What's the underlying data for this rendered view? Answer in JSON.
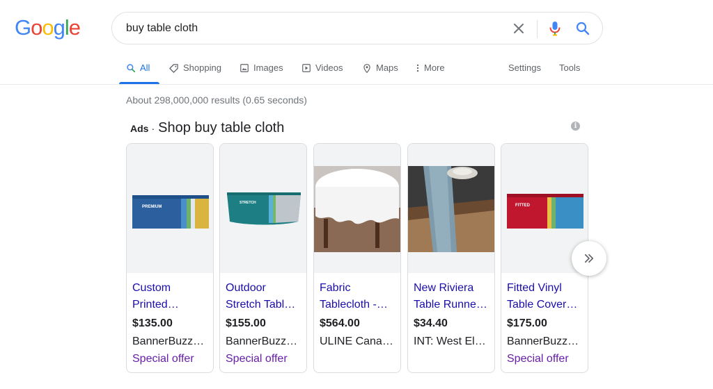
{
  "logo": {
    "letters": [
      "G",
      "o",
      "o",
      "g",
      "l",
      "e"
    ],
    "colors": [
      "#4285f4",
      "#ea4335",
      "#fbbc05",
      "#4285f4",
      "#34a853",
      "#ea4335"
    ]
  },
  "search": {
    "query": "buy table cloth",
    "icons": {
      "clear": "close-icon",
      "voice": "microphone-icon",
      "submit": "search-icon"
    }
  },
  "tabs": [
    {
      "label": "All",
      "icon": "search-icon",
      "active": true
    },
    {
      "label": "Shopping",
      "icon": "tag-icon",
      "active": false
    },
    {
      "label": "Images",
      "icon": "image-icon",
      "active": false
    },
    {
      "label": "Videos",
      "icon": "play-icon",
      "active": false
    },
    {
      "label": "Maps",
      "icon": "map-pin-icon",
      "active": false
    },
    {
      "label": "More",
      "icon": "more-vert-icon",
      "active": false
    }
  ],
  "tools": {
    "settings": "Settings",
    "tools": "Tools"
  },
  "result_stats": "About 298,000,000 results (0.65 seconds)",
  "ads": {
    "label": "Ads",
    "separator": "·",
    "title": "Shop buy table cloth",
    "info": "i"
  },
  "products": [
    {
      "title_1": "Custom",
      "title_2": "Printed…",
      "price": "$135.00",
      "merchant": "BannerBuzz…",
      "offer": "Special offer",
      "image_text": "PREMIUM"
    },
    {
      "title_1": "Outdoor",
      "title_2": "Stretch Tabl…",
      "price": "$155.00",
      "merchant": "BannerBuzz…",
      "offer": "Special offer",
      "image_text": "STRETCH"
    },
    {
      "title_1": "Fabric",
      "title_2": "Tablecloth -…",
      "price": "$564.00",
      "merchant": "ULINE Cana…",
      "offer": "",
      "image_text": ""
    },
    {
      "title_1": "New Riviera",
      "title_2": "Table Runne…",
      "price": "$34.40",
      "merchant": "INT: West El…",
      "offer": "",
      "image_text": ""
    },
    {
      "title_1": "Fitted Vinyl",
      "title_2": "Table Cover…",
      "price": "$175.00",
      "merchant": "BannerBuzz…",
      "offer": "Special offer",
      "image_text": "FITTED"
    }
  ],
  "colors": {
    "accent": "#1a73e8",
    "link": "#1a0dab",
    "offer": "#681da8",
    "muted": "#70757a"
  }
}
